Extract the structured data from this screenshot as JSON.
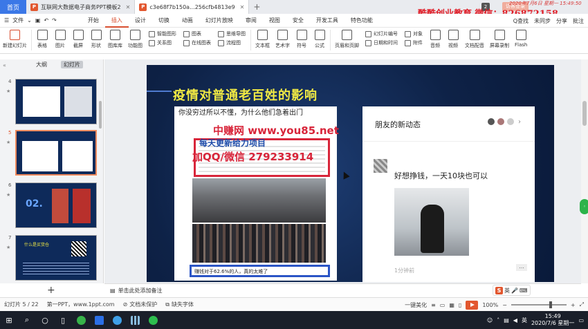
{
  "tabs": {
    "home": "首页",
    "doc1": "互联网大数据电子商务PPT模板2",
    "doc2": "c3e68f7b150a...256cfb4813e9",
    "badge": "2",
    "visitor": "访客登录"
  },
  "watermarks": {
    "top": "酷酷创业教育   微信：826872158",
    "top_time": "2020年7月6日 星期一 15:49:50",
    "site": "中赚网 www.you85.net",
    "line2": "每天更新给力项目",
    "line3": "加QQ/微信 279233914"
  },
  "menu": {
    "file": "文件",
    "items": [
      "开始",
      "插入",
      "设计",
      "切换",
      "动画",
      "幻灯片放映",
      "审阅",
      "视图",
      "安全",
      "开发工具",
      "特色功能"
    ],
    "active_index": 1,
    "search": "Q查找",
    "right": [
      "未同步",
      "分享",
      "批注"
    ]
  },
  "ribbon": {
    "new_slide": "新建幻灯片",
    "table": "表格",
    "image": "图片",
    "screenshot": "截屏",
    "shape": "形状",
    "gallery": "图库库",
    "feature_diagram": "功能图",
    "smart_art": "智能图形",
    "chart": "图表",
    "mind_map": "思维导图",
    "relation": "关系图",
    "online_chart": "在线图表",
    "flow_chart": "流程图",
    "text_box": "文本框",
    "art_text": "艺术字",
    "symbol": "符号",
    "formula": "公式",
    "header_footer": "页眉和页脚",
    "slide_number": "幻灯片编号",
    "object": "对象",
    "date_time": "日期和时间",
    "attachment": "附件",
    "audio": "音频",
    "video": "视频",
    "record_audio": "文档配音",
    "screen_record": "屏幕录制",
    "flash": "Flash",
    "hyperlink": "超链接"
  },
  "panel": {
    "outline": "大纲",
    "slides": "幻灯片",
    "thumbs": [
      {
        "num": "4",
        "star": "★"
      },
      {
        "num": "5",
        "star": "★"
      },
      {
        "num": "6",
        "star": "★"
      },
      {
        "num": "7",
        "star": "★"
      }
    ],
    "thumb6_text": "02.",
    "thumb7_text": "什么是买货仓"
  },
  "slide": {
    "title": "疫情对普通老百姓的影响",
    "left_text": "你没穷过所以不懂，为什么他们急着出门",
    "caption": "赚钱对于62.6%的人，真的太难了",
    "right_title": "朋友的新动态",
    "post_text": "好想挣钱，一天10块也可以",
    "post_time": "1分钟前",
    "dots": "..."
  },
  "notes": {
    "placeholder": "单击此处添加备注"
  },
  "status": {
    "slide_index": "幻灯片 5 / 22",
    "template": "第一PPT，www.1ppt.com",
    "protect": "文档未保护",
    "font_missing": "缺失字体",
    "beautify": "一键美化",
    "zoom": "100%"
  },
  "sogou": {
    "label": "英"
  },
  "taskbar": {
    "lang": "英",
    "time": "15:49",
    "date": "2020/7/6 星期一"
  }
}
